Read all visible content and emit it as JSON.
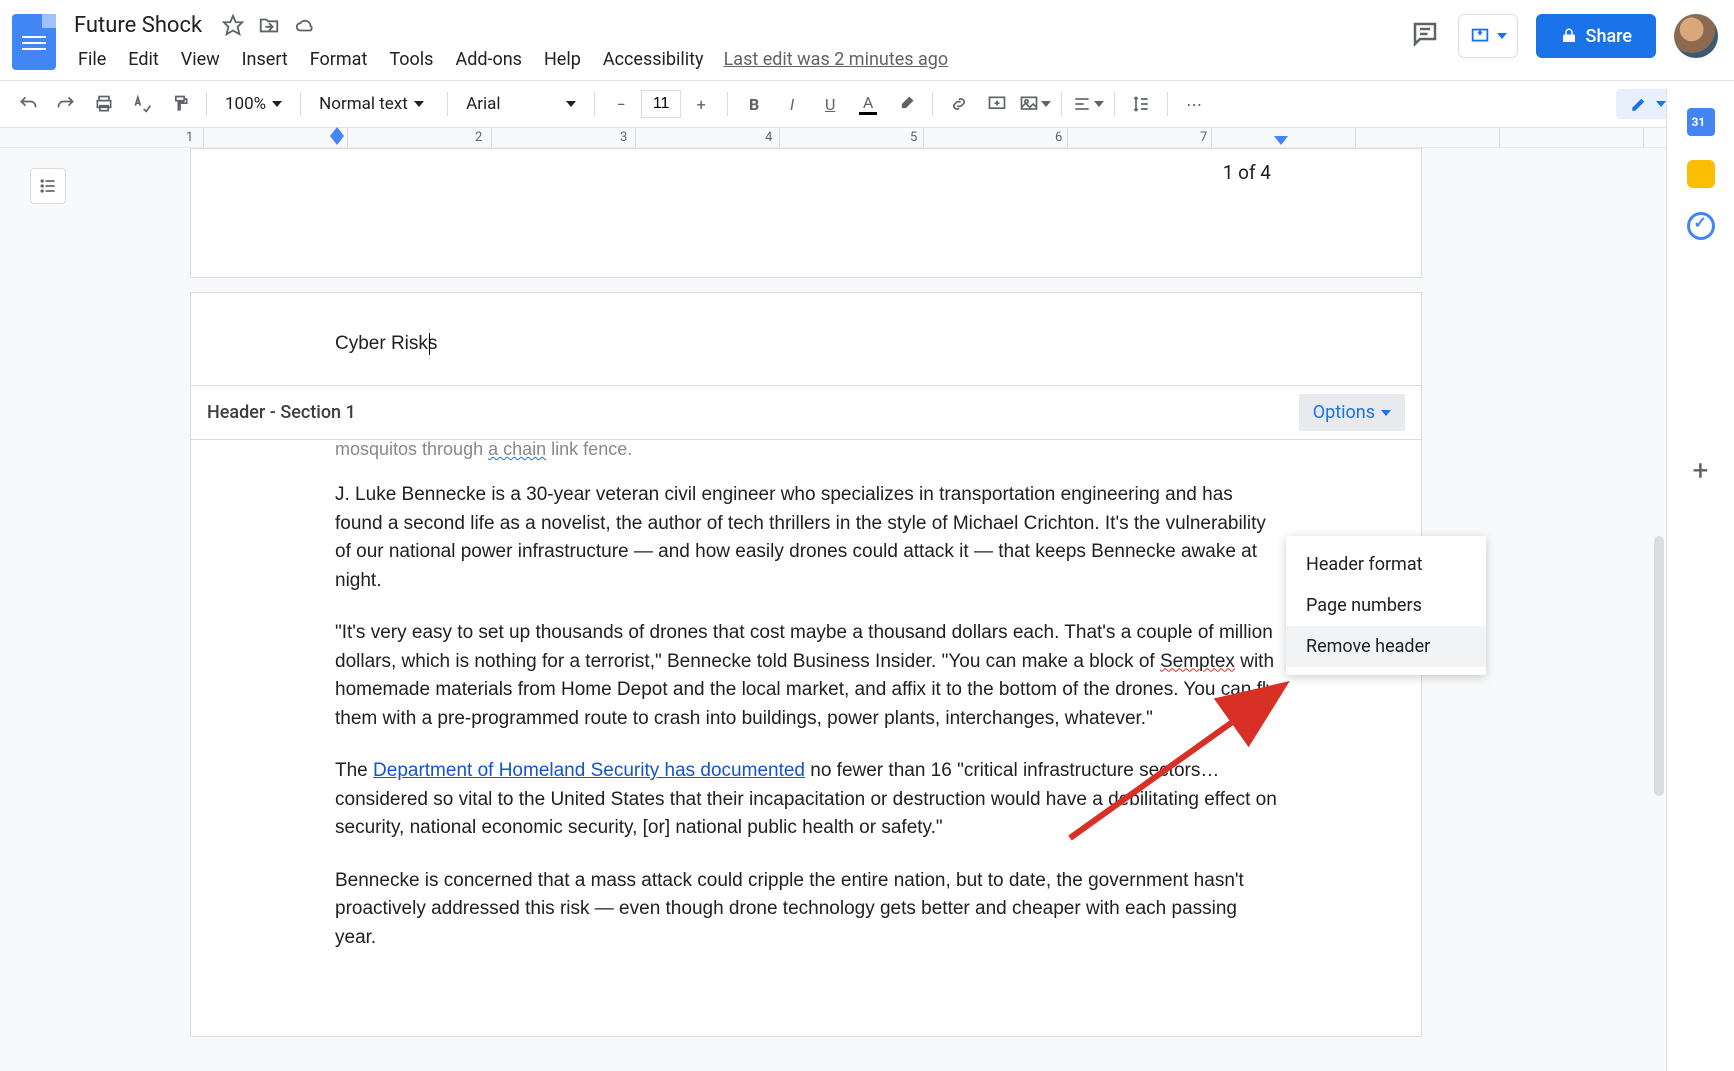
{
  "doc": {
    "title": "Future Shock",
    "last_edit": "Last edit was 2 minutes ago"
  },
  "menu": {
    "file": "File",
    "edit": "Edit",
    "view": "View",
    "insert": "Insert",
    "format": "Format",
    "tools": "Tools",
    "addons": "Add-ons",
    "help": "Help",
    "accessibility": "Accessibility"
  },
  "toolbar": {
    "zoom": "100%",
    "style": "Normal text",
    "font": "Arial",
    "size": "11"
  },
  "share": "Share",
  "ruler": [
    "1",
    "2",
    "3",
    "4",
    "5",
    "6",
    "7"
  ],
  "page": {
    "count": "1 of 4",
    "header_text": "Cyber Risks",
    "header_label": "Header - Section 1",
    "options_label": "Options",
    "truncated_line": "mosquitos through",
    "truncated_link": "a chain",
    "truncated_after": "link fence.",
    "p1": "J. Luke Bennecke is a 30-year veteran civil engineer who specializes in transportation engineering and has found a second life as a novelist, the author of tech thrillers in the style of Michael Crichton. It's the vulnerability of our national power infrastructure — and how easily drones could attack it — that keeps Bennecke awake at night.",
    "p2a": "\"It's very easy to set up thousands of drones that cost maybe a thousand dollars each. That's a couple of million dollars, which is nothing for a terrorist,\" Bennecke told Business Insider. \"You can make a block of ",
    "p2_err": "Semptex",
    "p2b": " with homemade materials from Home Depot and the local market, and affix it to the bottom of the drones. You can fly them with a pre-programmed route to crash into buildings, power plants, interchanges, whatever.\"",
    "p3a": "The ",
    "p3_link": "Department of Homeland Security has documented",
    "p3b": " no fewer than 16 \"critical infrastructure sectors… considered so vital to the United States that their incapacitation or destruction would have a debilitating effect on security, national economic security, [or] national public health or safety.\"",
    "p4": "Bennecke is concerned that a mass attack could cripple the entire nation, but to date, the government hasn't proactively addressed this risk — even though drone technology gets better and cheaper with each passing year."
  },
  "options_menu": {
    "header_format": "Header format",
    "page_numbers": "Page numbers",
    "remove_header": "Remove header"
  }
}
